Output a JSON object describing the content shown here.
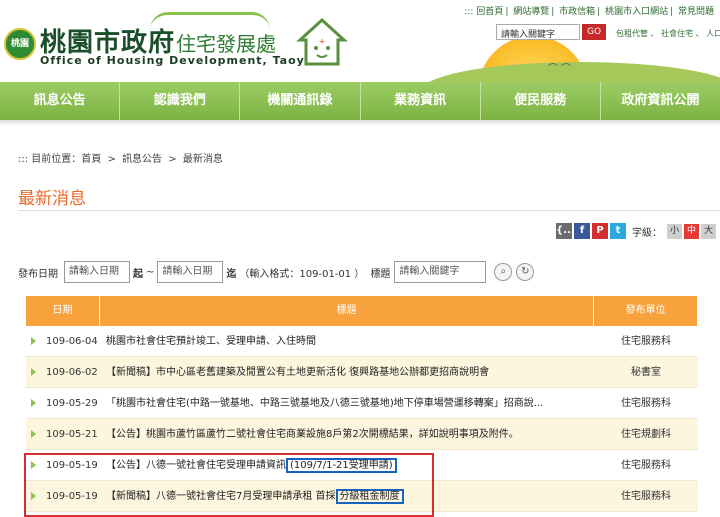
{
  "header": {
    "seal_text": "桃園",
    "logo_main": "桃園市政府",
    "logo_sub": "住宅發展處",
    "logo_en": "Office of Housing Development, Taoyuan",
    "top_links": [
      "::: 回首頁",
      "網站導覽",
      "市政信箱",
      "桃園市入口網站",
      "常見問題"
    ],
    "search_placeholder": "請輸入關鍵字",
    "go_label": "GO",
    "sub_links": "包租代管 、 社會住宅 、 人口"
  },
  "nav": {
    "items": [
      {
        "label": "訊息公告"
      },
      {
        "label": "認識我們"
      },
      {
        "label": "機關通訊錄"
      },
      {
        "label": "業務資訊"
      },
      {
        "label": "便民服務"
      },
      {
        "label": "政府資訊公開"
      }
    ]
  },
  "breadcrumb": {
    "prefix": ":::",
    "label": "目前位置：",
    "home": "首頁",
    "level1": "訊息公告",
    "level2": "最新消息",
    "sep": ">"
  },
  "page_title": "最新消息",
  "share": {
    "plurk": "{...}",
    "fb": "f",
    "p": "P",
    "t": "t",
    "font_label": "字級：",
    "font_small": "小",
    "font_medium": "中",
    "font_large": "大"
  },
  "filter": {
    "date_label": "發布日期",
    "start_placeholder": "請輸入日期",
    "start_badge": "起",
    "tilde": "~",
    "end_placeholder": "請輸入日期",
    "end_badge": "迄",
    "format_hint": "（輸入格式：109-01-01 ）",
    "keyword_label": "標題",
    "keyword_placeholder": "請輸入關鍵字"
  },
  "table": {
    "headers": [
      "日期",
      "標題",
      "發布單位"
    ],
    "rows": [
      {
        "date": "109-06-04",
        "title": "桃園市社會住宅預計竣工、受理申請、入住時間",
        "unit": "住宅服務科"
      },
      {
        "date": "109-06-02",
        "title": "【新聞稿】市中心區老舊建築及閒置公有土地更新活化 復興路基地公辦都更招商說明會",
        "unit": "秘書室"
      },
      {
        "date": "109-05-29",
        "title": "「桃園市社會住宅(中路一號基地、中路三號基地及八德三號基地)地下停車場營運移轉案」招商說...",
        "unit": "住宅服務科"
      },
      {
        "date": "109-05-21",
        "title": "【公告】桃園市蘆竹區蘆竹二號社會住宅商業設施8戶第2次開標結果，詳如說明事項及附件。",
        "unit": "住宅規劃科"
      },
      {
        "date": "109-05-19",
        "title": "【公告】八德一號社會住宅受理申請資訊",
        "title_hl": "(109/7/1-21受理申請)",
        "unit": "住宅服務科"
      },
      {
        "date": "109-05-19",
        "title": "【新聞稿】八德一號社會住宅7月受理申請承租 首採",
        "title_hl": "分級租金制度",
        "unit": "住宅服務科"
      }
    ]
  }
}
